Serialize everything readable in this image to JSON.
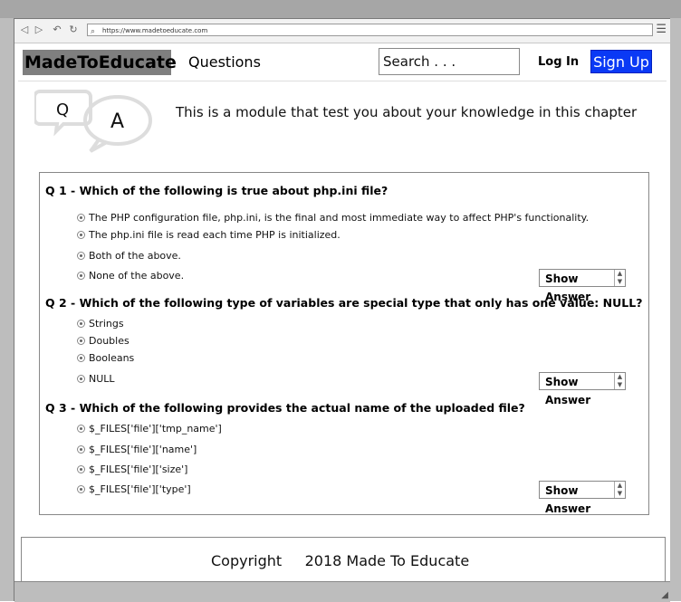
{
  "browser": {
    "url": "https://www.madetoeducate.com",
    "nav_icons": [
      "back-arrow-icon",
      "forward-arrow-icon",
      "undo-icon",
      "refresh-icon"
    ]
  },
  "header": {
    "brand": "MadeToEducate",
    "questions_link": "Questions",
    "search_placeholder": "Search . . .",
    "login": "Log In",
    "signup": "Sign Up",
    "signup_color": "#0a39f5"
  },
  "intro": {
    "logo_q": "Q",
    "logo_a": "A",
    "text": "This is a module that test you about your knowledge in this chapter"
  },
  "questions": [
    {
      "title": "Q 1 - Which of the following is true about php.ini file?",
      "options": [
        "The PHP configuration file, php.ini, is the final and most immediate way to affect PHP's functionality.",
        "The php.ini file is read each time PHP is initialized.",
        "Both of the above.",
        "None of the above."
      ],
      "button": "Show Answer"
    },
    {
      "title": "Q 2 - Which of the following type of variables are special type that only has one value: NULL?",
      "options": [
        "Strings",
        "Doubles",
        "Booleans",
        "NULL"
      ],
      "button": "Show Answer"
    },
    {
      "title": "Q 3 - Which of the following provides the actual name of the uploaded file?",
      "options": [
        "$_FILES['file']['tmp_name']",
        "$_FILES['file']['name']",
        "$_FILES['file']['size']",
        "$_FILES['file']['type']"
      ],
      "button": "Show Answer"
    }
  ],
  "footer": {
    "copyright": "Copyright     2018 Made To Educate"
  }
}
